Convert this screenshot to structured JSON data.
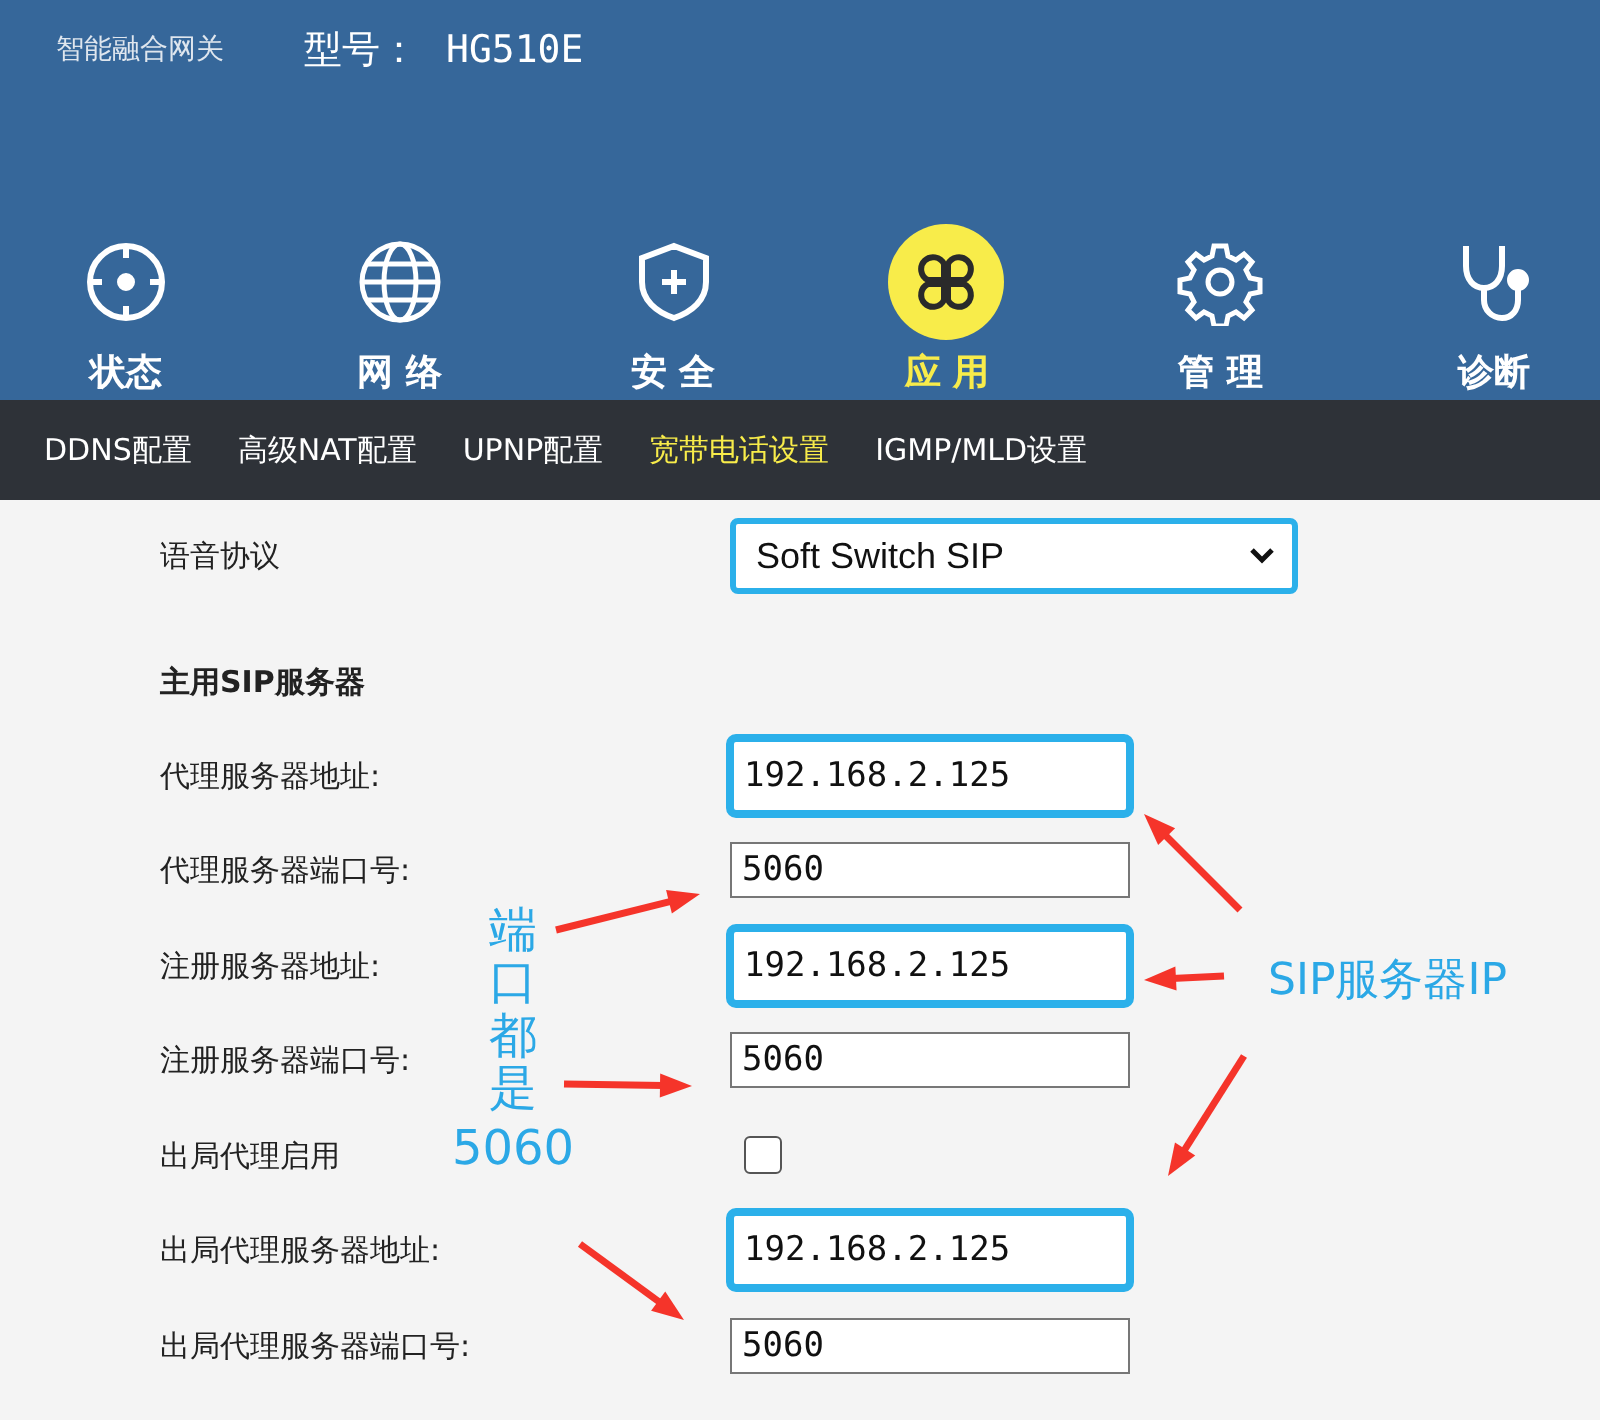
{
  "header": {
    "brand": "智能融合网关",
    "model_label": "型号：",
    "model": "HG510E"
  },
  "nav": [
    {
      "label": "状态",
      "selected": false
    },
    {
      "label": "网 络",
      "selected": false
    },
    {
      "label": "安 全",
      "selected": false
    },
    {
      "label": "应 用",
      "selected": true
    },
    {
      "label": "管 理",
      "selected": false
    },
    {
      "label": "诊断",
      "selected": false
    }
  ],
  "subnav": [
    {
      "label": "DDNS配置",
      "selected": false
    },
    {
      "label": "高级NAT配置",
      "selected": false
    },
    {
      "label": "UPNP配置",
      "selected": false
    },
    {
      "label": "宽带电话设置",
      "selected": true
    },
    {
      "label": "IGMP/MLD设置",
      "selected": false
    }
  ],
  "protocol": {
    "label": "语音协议",
    "value": "Soft Switch SIP",
    "highlighted": true
  },
  "section_title": "主用SIP服务器",
  "fields": [
    {
      "kind": "input",
      "label": "代理服务器地址:",
      "value": "192.168.2.125",
      "highlighted": true
    },
    {
      "kind": "input",
      "label": "代理服务器端口号:",
      "value": "5060",
      "highlighted": false
    },
    {
      "kind": "input",
      "label": "注册服务器地址:",
      "value": "192.168.2.125",
      "highlighted": true
    },
    {
      "kind": "input",
      "label": "注册服务器端口号:",
      "value": "5060",
      "highlighted": false
    },
    {
      "kind": "checkbox",
      "label": "出局代理启用",
      "checked": false
    },
    {
      "kind": "input",
      "label": "出局代理服务器地址:",
      "value": "192.168.2.125",
      "highlighted": true
    },
    {
      "kind": "input",
      "label": "出局代理服务器端口号:",
      "value": "5060",
      "highlighted": false
    }
  ],
  "annotations": {
    "port_note": "端口都是",
    "port_value": "5060",
    "ip_note": "SIP服务器IP"
  }
}
